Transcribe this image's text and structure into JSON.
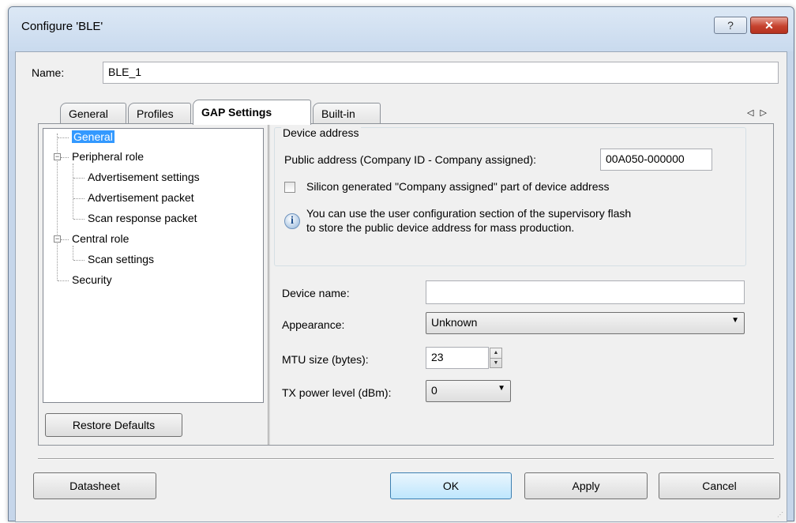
{
  "window": {
    "title": "Configure 'BLE'",
    "help_glyph": "?",
    "close_glyph": "✕"
  },
  "name_row": {
    "label": "Name:",
    "value": "BLE_1"
  },
  "tabs": [
    {
      "label": "General"
    },
    {
      "label": "Profiles"
    },
    {
      "label": "GAP Settings",
      "active": true
    },
    {
      "label": "Built-in"
    }
  ],
  "tab_scroll": {
    "left": "◁",
    "right": "▷"
  },
  "tree": {
    "items": [
      {
        "label": "General",
        "selected": true
      },
      {
        "label": "Peripheral role",
        "expander": "−"
      },
      {
        "label": "Advertisement settings"
      },
      {
        "label": "Advertisement packet"
      },
      {
        "label": "Scan response packet"
      },
      {
        "label": "Central role",
        "expander": "−"
      },
      {
        "label": "Scan settings"
      },
      {
        "label": "Security"
      }
    ]
  },
  "restore_defaults_label": "Restore Defaults",
  "device_address": {
    "group_title": "Device address",
    "public_address_label": "Public address (Company ID - Company assigned):",
    "public_address_value": "00A050-000000",
    "silicon_checkbox_label": "Silicon generated \"Company assigned\" part of device address",
    "silicon_checked": false,
    "info_icon_glyph": "i",
    "info_line1": "You can use the user configuration section of the supervisory flash",
    "info_line2": "to store the public device address for mass production."
  },
  "form": {
    "device_name_label": "Device name:",
    "device_name_value": "",
    "appearance_label": "Appearance:",
    "appearance_value": "Unknown",
    "mtu_label": "MTU size (bytes):",
    "mtu_value": "23",
    "tx_power_label": "TX power level (dBm):",
    "tx_power_value": "0",
    "combo_arrow": "▼",
    "spin_up": "▲",
    "spin_down": "▼"
  },
  "buttons": {
    "datasheet": "Datasheet",
    "ok": "OK",
    "apply": "Apply",
    "cancel": "Cancel"
  }
}
